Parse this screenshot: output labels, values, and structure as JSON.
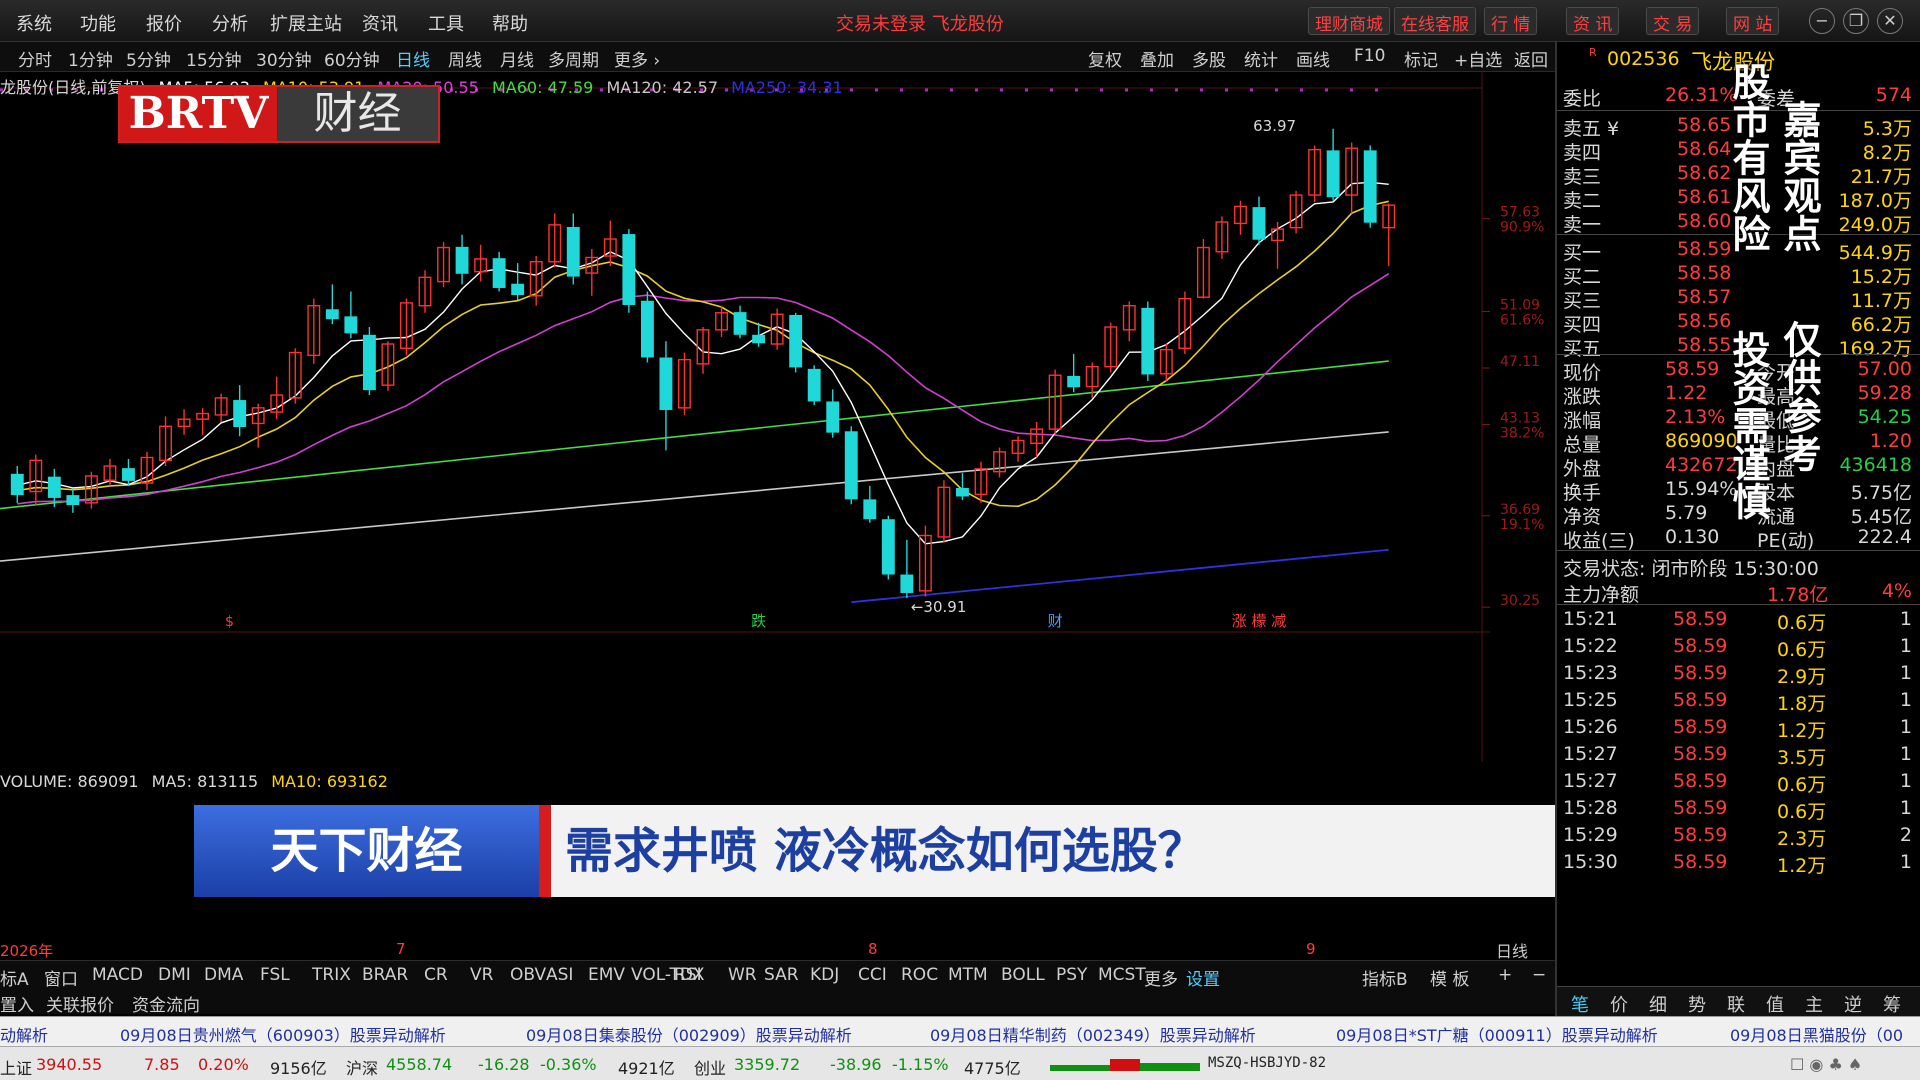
{
  "menu": {
    "items": [
      "系统",
      "功能",
      "报价",
      "分析",
      "扩展主站",
      "资讯",
      "工具",
      "帮助"
    ],
    "center_title": "交易未登录  飞龙股份",
    "right_buttons": [
      "理财商城",
      "在线客服",
      "行  情",
      "资  讯",
      "交  易",
      "网  站"
    ],
    "window_buttons": [
      "−",
      "❐",
      "✕"
    ]
  },
  "periods": {
    "left": [
      "分时",
      "1分钟",
      "5分钟",
      "15分钟",
      "30分钟",
      "60分钟",
      "日线",
      "周线",
      "月线",
      "多周期",
      "更多 ›"
    ],
    "active": "日线",
    "right": [
      "复权",
      "叠加",
      "多股",
      "统计",
      "画线",
      "F10",
      "标记",
      "+自选",
      "返回"
    ]
  },
  "chart_legend": {
    "prefix": "龙股份(日线,前复权)",
    "ma5": "MA5: 56.93",
    "ma10": "MA10: 53.91",
    "ma20": "MA20: 50.55",
    "ma60": "MA60: 47.59",
    "ma120": "MA120: 42.57",
    "ma250": "MA250: 34.31"
  },
  "brtv": {
    "red": "BRTV",
    "gray": "财经"
  },
  "price_axis": {
    "labels": [
      {
        "price": "57.63",
        "pct": "90.9%"
      },
      {
        "price": "51.09",
        "pct": "61.6%"
      },
      {
        "price": "47.11",
        "pct": ""
      },
      {
        "price": "43.13",
        "pct": "38.2%"
      },
      {
        "price": "36.69",
        "pct": "19.1%"
      },
      {
        "price": "30.25",
        "pct": ""
      }
    ]
  },
  "chart_annotations": {
    "high": "63.97",
    "low": "←30.91",
    "markers": [
      "跌",
      "财",
      "涨 檬 减"
    ]
  },
  "volume": {
    "label": "VOLUME: 869091",
    "ma5": "MA5: 813115",
    "ma10": "MA10: 693162"
  },
  "date_axis": {
    "labels": [
      "2026年",
      "7",
      "8",
      "9"
    ],
    "right": "日线"
  },
  "banner": {
    "left": "天下财经",
    "right": "需求井喷  液冷概念如何选股？"
  },
  "indicators": {
    "tabs": [
      "标A",
      "窗口",
      "MACD",
      "DMI",
      "DMA",
      "FSL",
      "TRIX",
      "BRAR",
      "CR",
      "VR",
      "OBV",
      "ASI",
      "EMV",
      "VOL-TDX",
      "RSI",
      "WR",
      "SAR",
      "KDJ",
      "CCI",
      "ROC",
      "MTM",
      "BOLL",
      "PSY",
      "MCST",
      "更多",
      "设置"
    ],
    "active": "设置",
    "right": [
      "指标B",
      "模 板",
      "+",
      "−"
    ]
  },
  "subbar": [
    "置入",
    "关联报价",
    "资金流向"
  ],
  "ticker": [
    "动解析",
    "09月08日贵州燃气（600903）股票异动解析",
    "09月08日集泰股份（002909）股票异动解析",
    "09月08日精华制药（002349）股票异动解析",
    "09月08日*ST广糖（000911）股票异动解析",
    "09月08日黑猫股份（00"
  ],
  "status": {
    "sh_label": "上证",
    "sh_value": "3940.55",
    "sh_chg": "7.85",
    "sh_pct": "0.20%",
    "sh_amt": "9156亿",
    "sz_label": "沪深",
    "sz_value": "4558.74",
    "sz_chg": "-16.28",
    "sz_pct": "-0.36%",
    "sz_amt": "4921亿",
    "cy_label": "创业",
    "cy_value": "3359.72",
    "cy_chg": "-38.96",
    "cy_pct": "-1.15%",
    "cy_amt": "4775亿",
    "server": "MSZQ-HSBJYD-82"
  },
  "quote": {
    "code": "002536",
    "name": "飞龙股份",
    "weibi": {
      "label": "委比",
      "pct": "26.31%",
      "diff_label": "委差",
      "diff": "574"
    },
    "asks": [
      {
        "label": "卖五 ¥",
        "price": "58.65",
        "vol": "5.3万"
      },
      {
        "label": "卖四",
        "price": "58.64",
        "vol": "8.2万"
      },
      {
        "label": "卖三",
        "price": "58.62",
        "vol": "21.7万"
      },
      {
        "label": "卖二",
        "price": "58.61",
        "vol": "187.0万"
      },
      {
        "label": "卖一",
        "price": "58.60",
        "vol": "249.0万"
      }
    ],
    "bids": [
      {
        "label": "买一",
        "price": "58.59",
        "vol": "544.9万"
      },
      {
        "label": "买二",
        "price": "58.58",
        "vol": "15.2万"
      },
      {
        "label": "买三",
        "price": "58.57",
        "vol": "11.7万"
      },
      {
        "label": "买四",
        "price": "58.56",
        "vol": "66.2万"
      },
      {
        "label": "买五",
        "price": "58.55",
        "vol": "169.2万"
      }
    ],
    "stats": [
      {
        "l1": "现价",
        "v1": "58.59",
        "l2": "今开",
        "v2": "57.00",
        "c1": "red",
        "c2": "red"
      },
      {
        "l1": "涨跌",
        "v1": "1.22",
        "l2": "最高",
        "v2": "59.28",
        "c1": "red",
        "c2": "red"
      },
      {
        "l1": "涨幅",
        "v1": "2.13%",
        "l2": "最低",
        "v2": "54.25",
        "c1": "red",
        "c2": "green"
      },
      {
        "l1": "总量",
        "v1": "869090",
        "l2": "量比",
        "v2": "1.20",
        "c1": "yellow",
        "c2": "red"
      },
      {
        "l1": "外盘",
        "v1": "432672",
        "l2": "内盘",
        "v2": "436418",
        "c1": "red",
        "c2": "green"
      },
      {
        "l1": "换手",
        "v1": "15.94%",
        "l2": "股本",
        "v2": "5.75亿",
        "c1": "white",
        "c2": "white"
      },
      {
        "l1": "净资",
        "v1": "5.79",
        "l2": "流通",
        "v2": "5.45亿",
        "c1": "white",
        "c2": "white"
      },
      {
        "l1": "收益(三)",
        "v1": "0.130",
        "l2": "PE(动)",
        "v2": "222.4",
        "c1": "white",
        "c2": "white"
      }
    ],
    "trade_state": "交易状态: 闭市阶段 15:30:00",
    "main_net": {
      "label": "主力净额",
      "value": "1.78亿",
      "pct": "4%"
    },
    "ticks": [
      {
        "t": "15:21",
        "p": "58.59",
        "v": "0.6万",
        "n": "1"
      },
      {
        "t": "15:22",
        "p": "58.59",
        "v": "0.6万",
        "n": "1"
      },
      {
        "t": "15:23",
        "p": "58.59",
        "v": "2.9万",
        "n": "1"
      },
      {
        "t": "15:25",
        "p": "58.59",
        "v": "1.8万",
        "n": "1"
      },
      {
        "t": "15:26",
        "p": "58.59",
        "v": "1.2万",
        "n": "1"
      },
      {
        "t": "15:27",
        "p": "58.59",
        "v": "3.5万",
        "n": "1"
      },
      {
        "t": "15:27",
        "p": "58.59",
        "v": "0.6万",
        "n": "1"
      },
      {
        "t": "15:28",
        "p": "58.59",
        "v": "0.6万",
        "n": "1"
      },
      {
        "t": "15:29",
        "p": "58.59",
        "v": "2.3万",
        "n": "2"
      },
      {
        "t": "15:30",
        "p": "58.59",
        "v": "1.2万",
        "n": "1"
      }
    ],
    "tabs": [
      "笔",
      "价",
      "细",
      "势",
      "联",
      "值",
      "主",
      "逆",
      "筹"
    ]
  },
  "overlay_text": {
    "col1": "股市有风险",
    "col2": "投资需谨慎",
    "col3": "嘉宾观点",
    "col4": "仅供参考"
  },
  "chart_data": {
    "type": "candlestick",
    "ylim": [
      30.25,
      63.97
    ],
    "candles": [
      [
        39.6,
        40.2,
        37.6,
        38.2
      ],
      [
        38.4,
        41.0,
        37.4,
        40.6
      ],
      [
        39.4,
        40.0,
        37.3,
        38.0
      ],
      [
        38.1,
        38.6,
        36.9,
        37.5
      ],
      [
        37.6,
        39.8,
        37.2,
        39.5
      ],
      [
        39.2,
        40.7,
        38.8,
        40.2
      ],
      [
        40.0,
        40.7,
        38.8,
        39.2
      ],
      [
        39.0,
        41.2,
        38.5,
        40.8
      ],
      [
        40.6,
        43.7,
        40.2,
        43.0
      ],
      [
        43.0,
        44.2,
        42.4,
        43.5
      ],
      [
        43.5,
        44.3,
        42.4,
        43.9
      ],
      [
        43.8,
        45.3,
        43.3,
        45.0
      ],
      [
        44.8,
        45.9,
        42.3,
        43.0
      ],
      [
        43.2,
        44.6,
        41.5,
        44.3
      ],
      [
        44.0,
        46.5,
        43.5,
        45.2
      ],
      [
        45.0,
        48.5,
        44.6,
        48.2
      ],
      [
        48.0,
        52.0,
        47.4,
        51.5
      ],
      [
        51.2,
        53.0,
        50.2,
        50.6
      ],
      [
        50.7,
        52.5,
        49.2,
        49.6
      ],
      [
        49.4,
        50.0,
        45.2,
        45.6
      ],
      [
        45.9,
        49.0,
        45.5,
        48.8
      ],
      [
        48.5,
        52.0,
        48.0,
        51.7
      ],
      [
        51.5,
        54.0,
        51.0,
        53.5
      ],
      [
        53.2,
        56.0,
        52.8,
        55.6
      ],
      [
        55.6,
        56.5,
        53.0,
        53.8
      ],
      [
        53.9,
        55.8,
        53.2,
        54.8
      ],
      [
        54.8,
        55.3,
        52.5,
        52.8
      ],
      [
        53.0,
        54.5,
        51.9,
        52.3
      ],
      [
        52.2,
        55.0,
        51.5,
        54.6
      ],
      [
        54.6,
        58.0,
        54.2,
        57.2
      ],
      [
        57.0,
        58.0,
        53.0,
        53.6
      ],
      [
        53.8,
        55.5,
        52.2,
        54.9
      ],
      [
        55.0,
        57.5,
        54.3,
        56.2
      ],
      [
        56.5,
        56.9,
        51.0,
        51.6
      ],
      [
        51.8,
        52.5,
        47.5,
        47.9
      ],
      [
        47.8,
        49.0,
        41.3,
        44.2
      ],
      [
        44.3,
        48.2,
        43.8,
        47.7
      ],
      [
        47.4,
        50.0,
        46.7,
        49.8
      ],
      [
        49.8,
        51.5,
        49.3,
        51.0
      ],
      [
        51.0,
        51.5,
        49.2,
        49.5
      ],
      [
        49.4,
        50.3,
        48.6,
        48.9
      ],
      [
        48.8,
        51.3,
        48.4,
        50.9
      ],
      [
        50.8,
        51.0,
        46.8,
        47.2
      ],
      [
        47.0,
        47.3,
        44.5,
        44.8
      ],
      [
        44.7,
        45.6,
        42.2,
        42.6
      ],
      [
        42.6,
        43.0,
        37.5,
        37.9
      ],
      [
        37.8,
        38.8,
        36.2,
        36.5
      ],
      [
        36.4,
        36.7,
        32.2,
        32.6
      ],
      [
        32.5,
        35.0,
        30.9,
        31.3
      ],
      [
        31.4,
        36.0,
        31.0,
        35.3
      ],
      [
        35.2,
        39.2,
        34.8,
        38.7
      ],
      [
        38.6,
        39.7,
        37.8,
        38.1
      ],
      [
        38.2,
        40.5,
        37.6,
        40.0
      ],
      [
        39.8,
        41.5,
        39.4,
        41.2
      ],
      [
        41.1,
        42.3,
        40.5,
        42.0
      ],
      [
        41.8,
        43.3,
        40.8,
        42.8
      ],
      [
        42.8,
        47.0,
        42.4,
        46.6
      ],
      [
        46.5,
        48.1,
        45.4,
        45.8
      ],
      [
        45.8,
        47.5,
        45.0,
        47.2
      ],
      [
        47.2,
        50.3,
        46.8,
        50.0
      ],
      [
        49.8,
        51.8,
        49.0,
        51.5
      ],
      [
        51.3,
        51.8,
        46.2,
        46.7
      ],
      [
        46.7,
        48.8,
        46.2,
        48.4
      ],
      [
        48.5,
        52.5,
        48.1,
        52.0
      ],
      [
        52.1,
        56.2,
        52.0,
        55.6
      ],
      [
        55.3,
        57.8,
        54.8,
        57.4
      ],
      [
        57.3,
        58.9,
        56.5,
        58.5
      ],
      [
        58.4,
        59.2,
        55.8,
        56.2
      ],
      [
        56.1,
        57.4,
        54.1,
        56.9
      ],
      [
        57.0,
        59.6,
        56.6,
        59.3
      ],
      [
        59.3,
        62.8,
        58.8,
        62.5
      ],
      [
        62.4,
        63.97,
        58.9,
        59.2
      ],
      [
        59.3,
        63.0,
        58.0,
        62.6
      ],
      [
        62.4,
        62.8,
        57.0,
        57.4
      ],
      [
        57.0,
        58.7,
        54.3,
        58.59
      ]
    ],
    "volume_heights": [
      0.34,
      0.31,
      0.3,
      0.29,
      0.38,
      0.36,
      0.32,
      0.34,
      0.4,
      0.38,
      0.33,
      0.34,
      0.36,
      0.35,
      0.36,
      0.38,
      0.42,
      0.4,
      0.38,
      0.36,
      0.38,
      0.41,
      0.4,
      0.43,
      0.4,
      0.38,
      0.39,
      0.37,
      0.39,
      0.42,
      0.4,
      0.38,
      0.39,
      0.4,
      0.39,
      0.42,
      0.4,
      0.4,
      0.39,
      0.38,
      0.37,
      0.39,
      0.38,
      0.4,
      0.39,
      0.41,
      0.4,
      0.43,
      0.4,
      0.41,
      0.4,
      0.39,
      0.4,
      0.41,
      0.42,
      0.4,
      0.43,
      0.41,
      0.4,
      0.42,
      0.41,
      0.4,
      0.42,
      0.44,
      0.43,
      0.42,
      0.41,
      0.43,
      0.42,
      0.46,
      0.45,
      0.43,
      0.44,
      0.44,
      0.42
    ]
  }
}
